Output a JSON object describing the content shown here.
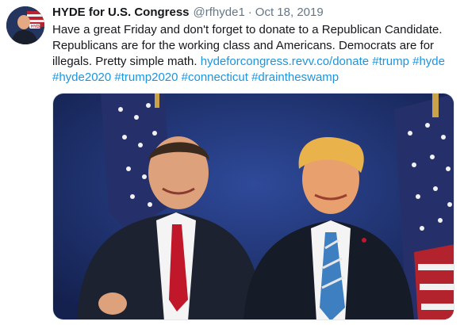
{
  "tweet": {
    "author_name": "HYDE for U.S. Congress",
    "handle": "@rfhyde1",
    "separator": "·",
    "date": "Oct 18, 2019",
    "text_parts": [
      "Have a great Friday and don't forget to donate to a Republican Candidate. Republicans are for the working class and Americans. Democrats are for illegals. Pretty simple math. "
    ],
    "links": [
      "hydeforcongress.revv.co/donate",
      "#trump",
      "#hyde",
      "#hyde2020",
      "#trump2020",
      "#connecticut",
      "#draintheswamp"
    ],
    "avatar_icon": "profile-photo",
    "media_icon": "photo-two-men-with-flags"
  },
  "colors": {
    "link": "#1b95e0",
    "secondary_text": "#657786",
    "primary_text": "#14171a",
    "photo_background": "#1d2f6b"
  }
}
